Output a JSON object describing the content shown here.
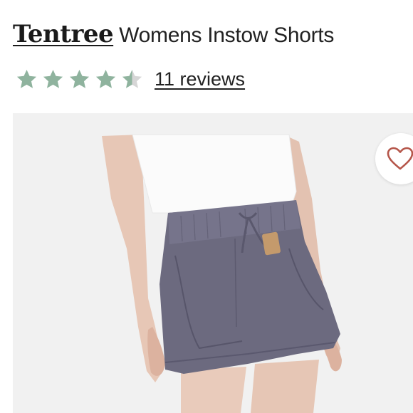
{
  "product": {
    "brand": "Tentree",
    "name": "Womens Instow Shorts"
  },
  "rating": {
    "value": 4.5,
    "max": 5,
    "reviews_label": "11 reviews",
    "star_color": "#8fb39e",
    "empty_star_color": "#d6d6d6"
  },
  "favorite": {
    "icon": "heart-outline-icon",
    "color": "#b5564a"
  },
  "image": {
    "background": "#f1f1f1"
  }
}
